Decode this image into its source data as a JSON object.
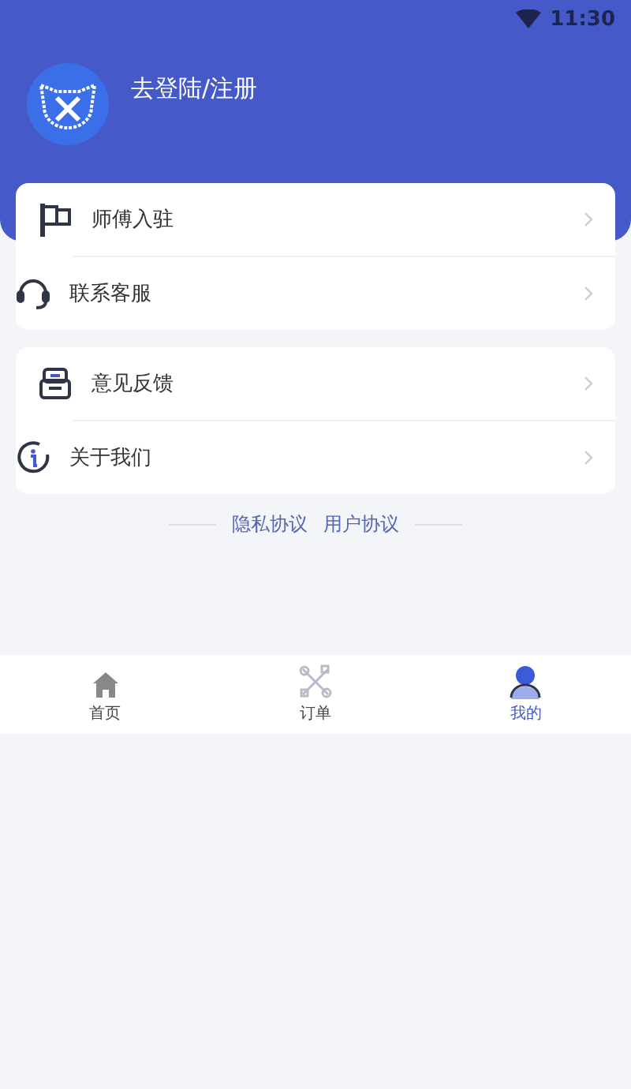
{
  "status_bar": {
    "time": "11:30"
  },
  "profile": {
    "login_text": "去登陆/注册"
  },
  "menu_groups": [
    {
      "items": [
        {
          "label": "师傅入驻"
        },
        {
          "label": "联系客服"
        }
      ]
    },
    {
      "items": [
        {
          "label": "意见反馈"
        },
        {
          "label": "关于我们"
        }
      ]
    }
  ],
  "footer_links": [
    "隐私协议",
    "用户协议"
  ],
  "tab_bar": [
    {
      "label": "首页",
      "selected": false
    },
    {
      "label": "订单",
      "selected": false
    },
    {
      "label": "我的",
      "selected": true
    }
  ]
}
